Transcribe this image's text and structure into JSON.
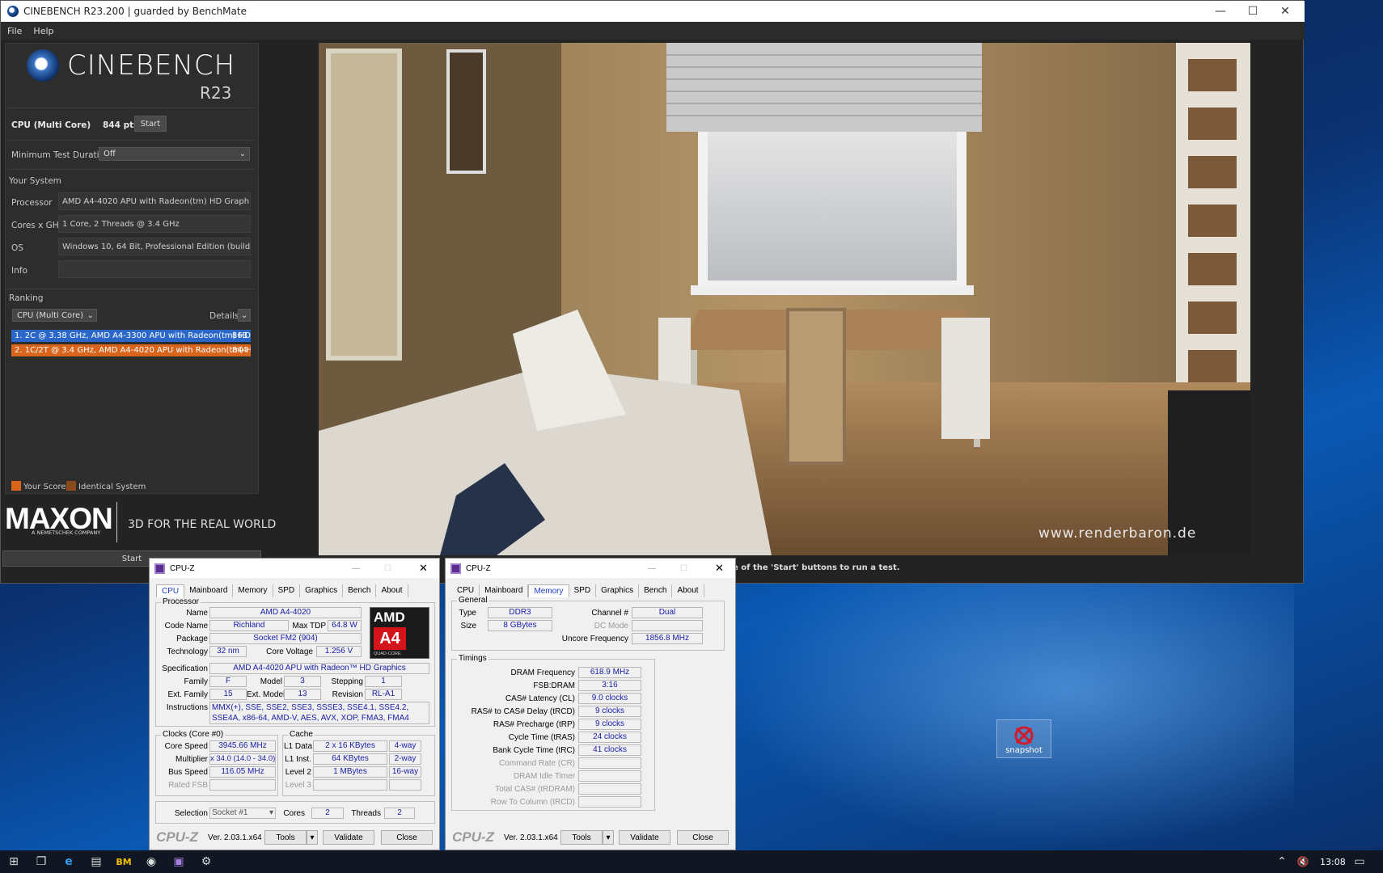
{
  "cinebench": {
    "window_title": "CINEBENCH R23.200 | guarded by BenchMate",
    "menu": [
      "File",
      "Help"
    ],
    "logo_text": "CINEBENCH",
    "logo_sub": "R23",
    "test_label": "CPU (Multi Core)",
    "score": "844 pts",
    "start_label": "Start",
    "min_duration_label": "Minimum Test Duration",
    "min_duration_value": "Off",
    "your_system_label": "Your System",
    "system": {
      "processor_label": "Processor",
      "processor": "AMD A4-4020 APU with Radeon(tm) HD Graphics",
      "cores_label": "Cores x GHz",
      "cores": "1 Core, 2 Threads @ 3.4 GHz",
      "os_label": "OS",
      "os": "Windows 10, 64 Bit, Professional Edition (build 15063)",
      "info_label": "Info",
      "info": ""
    },
    "ranking_label": "Ranking",
    "ranking_select": "CPU (Multi Core)",
    "details_label": "Details",
    "ranking": [
      {
        "text": "1. 2C @ 3.38 GHz, AMD A4-3300 APU with Radeon(tm) HD",
        "score": "863",
        "color": "#2b67c8"
      },
      {
        "text": "2. 1C/2T @ 3.4 GHz, AMD A4-4020 APU with Radeon(tm) H",
        "score": "844",
        "color": "#d9651c"
      }
    ],
    "legend_your": "Your Score",
    "legend_identical": "Identical System",
    "maxon_logo": "MAXON",
    "maxon_sub": "A NEMETSCHEK COMPANY",
    "maxon_tagline": "3D FOR THE REAL WORLD",
    "bottom_start": "Start",
    "watermark": "www.renderbaron.de",
    "status": "e of the 'Start' buttons to run a test."
  },
  "cpuz_cpu": {
    "title": "CPU-Z",
    "tabs": [
      "CPU",
      "Mainboard",
      "Memory",
      "SPD",
      "Graphics",
      "Bench",
      "About"
    ],
    "active_tab": "CPU",
    "processor_group": "Processor",
    "name_label": "Name",
    "name": "AMD A4-4020",
    "codename_label": "Code Name",
    "codename": "Richland",
    "maxtdp_label": "Max TDP",
    "maxtdp": "64.8 W",
    "package_label": "Package",
    "package": "Socket FM2 (904)",
    "tech_label": "Technology",
    "tech": "32 nm",
    "voltage_label": "Core Voltage",
    "voltage": "1.256 V",
    "spec_label": "Specification",
    "spec": "AMD A4-4020 APU with Radeon™ HD Graphics",
    "family_label": "Family",
    "family": "F",
    "model_label": "Model",
    "model": "3",
    "stepping_label": "Stepping",
    "stepping": "1",
    "extfamily_label": "Ext. Family",
    "extfamily": "15",
    "extmodel_label": "Ext. Model",
    "extmodel": "13",
    "revision_label": "Revision",
    "revision": "RL-A1",
    "instr_label": "Instructions",
    "instr": "MMX(+), SSE, SSE2, SSE3, SSSE3, SSE4.1, SSE4.2, SSE4A, x86-64, AMD-V, AES, AVX, XOP, FMA3, FMA4",
    "logo_brand": "AMD",
    "logo_model": "A4",
    "logo_sub": "QUAD-CORE",
    "clocks_group": "Clocks (Core #0)",
    "corespeed_label": "Core Speed",
    "corespeed": "3945.66 MHz",
    "multiplier_label": "Multiplier",
    "multiplier": "x 34.0 (14.0 - 34.0)",
    "busspeed_label": "Bus Speed",
    "busspeed": "116.05 MHz",
    "ratedfsb_label": "Rated FSB",
    "ratedfsb": "",
    "cache_group": "Cache",
    "l1d_label": "L1 Data",
    "l1d": "2 x 16 KBytes",
    "l1d_way": "4-way",
    "l1i_label": "L1 Inst.",
    "l1i": "64 KBytes",
    "l1i_way": "2-way",
    "l2_label": "Level 2",
    "l2": "1 MBytes",
    "l2_way": "16-way",
    "l3_label": "Level 3",
    "l3": "",
    "l3_way": "",
    "selection_label": "Selection",
    "selection": "Socket #1",
    "cores_label": "Cores",
    "cores": "2",
    "threads_label": "Threads",
    "threads": "2",
    "brand": "CPU-Z",
    "version": "Ver. 2.03.1.x64",
    "tools_label": "Tools",
    "validate_label": "Validate",
    "close_label": "Close"
  },
  "cpuz_mem": {
    "title": "CPU-Z",
    "tabs": [
      "CPU",
      "Mainboard",
      "Memory",
      "SPD",
      "Graphics",
      "Bench",
      "About"
    ],
    "active_tab": "Memory",
    "general_group": "General",
    "type_label": "Type",
    "type": "DDR3",
    "size_label": "Size",
    "size": "8 GBytes",
    "channel_label": "Channel #",
    "channel": "Dual",
    "dcmode_label": "DC Mode",
    "dcmode": "",
    "uncore_label": "Uncore Frequency",
    "uncore": "1856.8 MHz",
    "timings_group": "Timings",
    "timings": [
      {
        "label": "DRAM Frequency",
        "value": "618.9 MHz",
        "dim": false
      },
      {
        "label": "FSB:DRAM",
        "value": "3:16",
        "dim": false
      },
      {
        "label": "CAS# Latency (CL)",
        "value": "9.0 clocks",
        "dim": false
      },
      {
        "label": "RAS# to CAS# Delay (tRCD)",
        "value": "9 clocks",
        "dim": false
      },
      {
        "label": "RAS# Precharge (tRP)",
        "value": "9 clocks",
        "dim": false
      },
      {
        "label": "Cycle Time (tRAS)",
        "value": "24 clocks",
        "dim": false
      },
      {
        "label": "Bank Cycle Time (tRC)",
        "value": "41 clocks",
        "dim": false
      },
      {
        "label": "Command Rate (CR)",
        "value": "",
        "dim": true
      },
      {
        "label": "DRAM Idle Timer",
        "value": "",
        "dim": true
      },
      {
        "label": "Total CAS# (tRDRAM)",
        "value": "",
        "dim": true
      },
      {
        "label": "Row To Column (tRCD)",
        "value": "",
        "dim": true
      }
    ],
    "brand": "CPU-Z",
    "version": "Ver. 2.03.1.x64",
    "tools_label": "Tools",
    "validate_label": "Validate",
    "close_label": "Close"
  },
  "desktop": {
    "snapshot_label": "snapshot"
  },
  "taskbar": {
    "time": "13:08"
  }
}
